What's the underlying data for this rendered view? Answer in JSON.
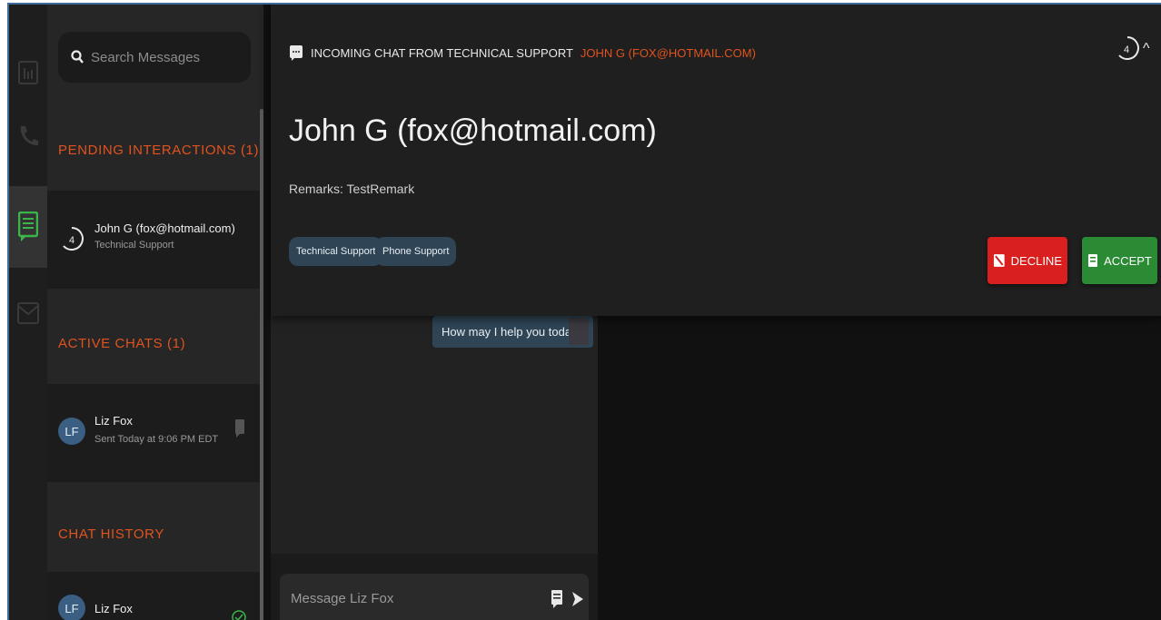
{
  "search": {
    "placeholder": "Search Messages"
  },
  "sidebar": {
    "pending_header": "PENDING INTERACTIONS (1)",
    "pending_item": {
      "timer": "4",
      "title": "John G (fox@hotmail.com)",
      "subtitle": "Technical Support"
    },
    "active_header": "ACTIVE CHATS (1)",
    "active_item": {
      "initials": "LF",
      "title": "Liz Fox",
      "subtitle": "Sent Today at 9:06 PM EDT"
    },
    "history_header": "CHAT HISTORY",
    "history_item": {
      "initials": "LF",
      "title": "Liz Fox"
    }
  },
  "chat": {
    "bubble": "How may I help you today?",
    "composer_placeholder": "Message Liz Fox"
  },
  "incoming": {
    "header_label": "INCOMING CHAT FROM TECHNICAL SUPPORT",
    "header_from": "JOHN G (FOX@HOTMAIL.COM)",
    "title": "John G (fox@hotmail.com)",
    "remarks": "Remarks: TestRemark",
    "chips": [
      "Technical Support",
      "Phone Support"
    ],
    "decline_label": "DECLINE",
    "accept_label": "ACCEPT",
    "timer": "4",
    "collapse_glyph": "^"
  },
  "colors": {
    "accent_orange": "#e0531f",
    "decline_red": "#d9201f",
    "accept_green": "#2b8a34",
    "chip_blue": "#2f4556",
    "active_icon_green": "#39b54a"
  },
  "icons": [
    "search-icon",
    "dashboard-icon",
    "phone-icon",
    "chat-icon",
    "mail-icon",
    "timer-icon",
    "message-icon",
    "decline-icon",
    "accept-icon",
    "send-icon",
    "canned-response-icon",
    "check-icon",
    "chevron-up-icon"
  ]
}
